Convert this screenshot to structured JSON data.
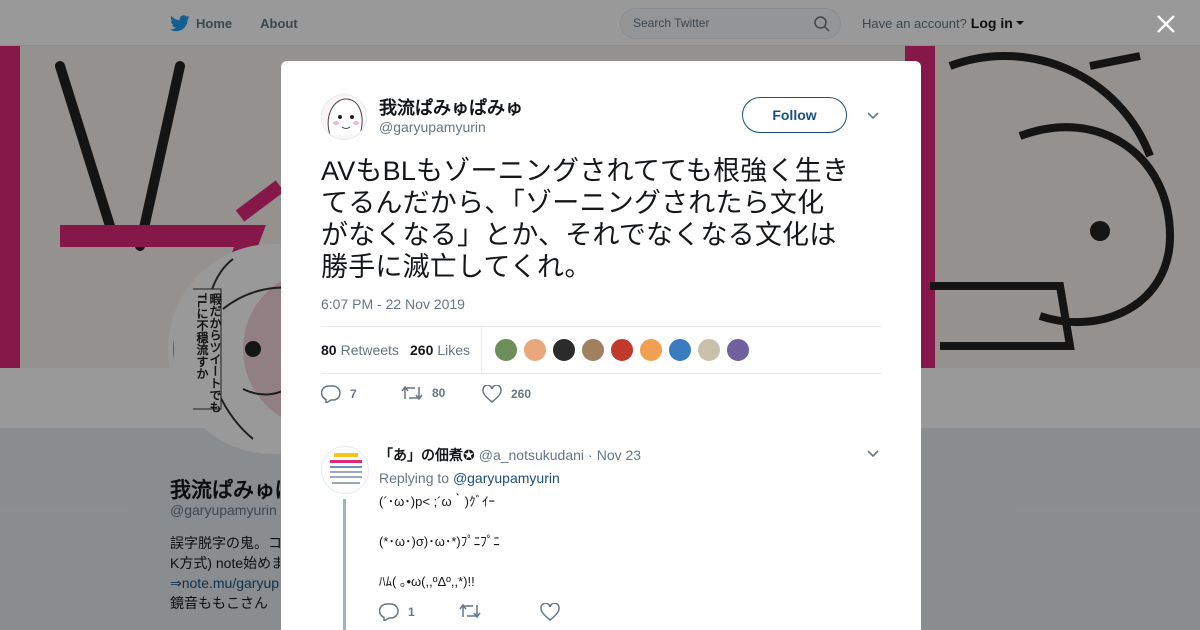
{
  "topnav": {
    "home_label": "Home",
    "about_label": "About",
    "search_placeholder": "Search Twitter",
    "account_prompt": "Have an account?",
    "login_label": "Log in"
  },
  "profile": {
    "name": "我流ぱみゅぱみゅ",
    "handle": "@garyupamyurin",
    "bio_lines": [
      "誤字脱字の鬼。コ",
      "K方式) note始めま",
      "⇒note.mu/garyup",
      "鏡音ももこさん"
    ],
    "bubble_text": "暇だからツイートでもTLに不穏流すか"
  },
  "tweet": {
    "author_name": "我流ぱみゅぱみゅ",
    "author_handle": "@garyupamyurin",
    "follow_label": "Follow",
    "text_lines": [
      "AVもBLもゾーニングされてても根強く生き",
      "てるんだから、「ゾーニングされたら文化",
      "がなくなる」とか、それでなくなる文化は",
      "勝手に滅亡してくれ。"
    ],
    "timestamp": "6:07 PM - 22 Nov 2019",
    "retweets_count": "80",
    "retweets_label": "Retweets",
    "likes_count": "260",
    "likes_label": "Likes",
    "liker_colors": [
      "#6b8e5a",
      "#e8a87c",
      "#2b2b2b",
      "#a08060",
      "#c0392b",
      "#f0a050",
      "#3a7bbf",
      "#c8c0a8",
      "#7060a0"
    ],
    "action_reply_count": "7",
    "action_retweet_count": "80",
    "action_like_count": "260"
  },
  "reply": {
    "author_name": "「あ」の佃煮✪",
    "author_handle": "@a_notsukudani",
    "date": "Nov 23",
    "date_separator": "·",
    "replying_prefix": "Replying to",
    "replying_to": "@garyupamyurin",
    "text_lines": [
      "(´･ω･)p< ;´ω｀)ｸﾞｲｰ",
      "(*･ω･)σ)･ω･*)ﾌﾟﾆﾌﾟﾆ",
      "ﾊﾑ( ｡•ω(,,ºΔº,,*)!!"
    ],
    "reply_count": "1"
  },
  "colors": {
    "link": "#1b4f80",
    "banner_magenta": "#e0287a",
    "muted": "#657786"
  }
}
